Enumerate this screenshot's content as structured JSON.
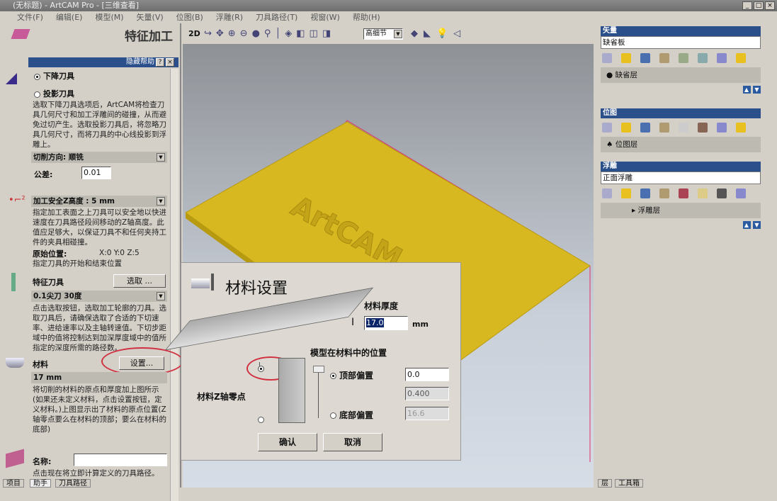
{
  "window": {
    "title": "(无标题) - ArtCAM Pro - [三维查看]"
  },
  "menu": [
    "文件(F)",
    "编辑(E)",
    "模型(M)",
    "矢量(V)",
    "位图(B)",
    "浮雕(R)",
    "刀具路径(T)",
    "视窗(W)",
    "帮助(H)"
  ],
  "left": {
    "title": "特征加工",
    "help_bar": "隐藏帮助",
    "radio_drop": "下降刀具",
    "radio_project": "投影刀具",
    "tool_desc": "选取下降刀具选项后，ArtCAM将检查刀具几何尺寸和加工浮雕间的碰撞，从而避免过切产生。选取投影刀具后，将忽略刀具几何尺寸，而将刀具的中心线投影到浮雕上。",
    "cut_dir": "切削方向: 顺铣",
    "tolerance_label": "公差:",
    "tolerance_value": "0.01",
    "safe_z": "加工安全Z高度 : 5 mm",
    "safe_z_desc": "指定加工表面之上刀具可以安全地以快进速度在刀具路径段间移动的Z轴高度。此值应足够大，以保证刀具不和任何夹持工件的夹具相碰撞。",
    "home_label": "原始位置:",
    "home_value": "X:0 Y:0 Z:5",
    "home_desc": "指定刀具的开始和结束位置",
    "feature_tool": "特征刀具",
    "select_btn": "选取 ...",
    "tool_value": "0.1尖刀 30度",
    "tool_select_desc": "点击选取按钮，选取加工轮廓的刀具。选取刀具后，请确保选取了合适的下切速率、进给速率以及主轴转速值。下切步距域中的值将控制达到加深厚度域中的值所指定的深度所需的路径数。",
    "material": "材料",
    "setup_btn": "设置...",
    "material_value": "17 mm",
    "material_desc": "将切削的材料的原点和厚度加上图所示(如果还未定义材料，点击设置按钮，定义材料。)上图显示出了材料的原点位置(Z轴零点要么在材料的顶部；要么在材料的底部)",
    "name_label": "名称:",
    "name_value": "",
    "calc_desc": "点击现在将立即计算定义的刀具路径。",
    "tabs": [
      "项目",
      "助手",
      "刀具路径"
    ]
  },
  "toolbar": {
    "mode": "2D",
    "detail": "高细节"
  },
  "dialog": {
    "title": "材料设置",
    "thickness_label": "材料厚度",
    "thickness_value": "17.0",
    "unit": "mm",
    "position_label": "模型在材料中的位置",
    "zero_label": "材料Z轴零点",
    "top_offset": "顶部偏置",
    "top_value": "0.0",
    "mid_value": "0.400",
    "bottom_offset": "底部偏置",
    "bottom_value": "16.6",
    "ok": "确认",
    "cancel": "取消"
  },
  "right": {
    "vector": {
      "title": "矢量",
      "combo": "缺省板",
      "layer": "缺省层"
    },
    "bitmap": {
      "title": "位图",
      "layer": "位图层"
    },
    "relief": {
      "title": "浮雕",
      "combo": "正面浮雕",
      "layer": "浮雕层"
    },
    "tabs": [
      "层",
      "工具箱"
    ]
  },
  "colors": {
    "relief": "#d8b820",
    "bounding_box": "#e0306a",
    "panel_header": "#2a4f8a",
    "highlight": "#d03040"
  }
}
